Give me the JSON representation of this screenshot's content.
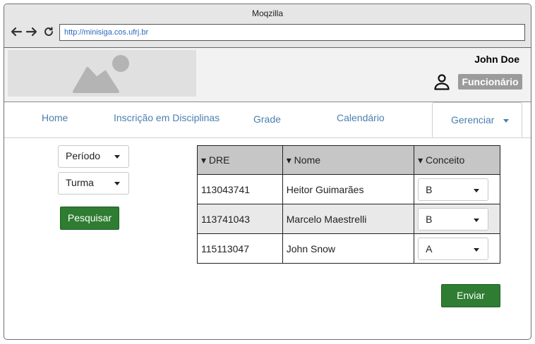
{
  "window": {
    "title": "Moqzilla"
  },
  "browser": {
    "url": "http://minisiga.cos.ufrj.br"
  },
  "header": {
    "user_name": "John Doe",
    "role": "Funcionário"
  },
  "tabs": [
    {
      "label": "Home"
    },
    {
      "label": "Inscrição em Disciplinas"
    },
    {
      "label": "Grade"
    },
    {
      "label": "Calendário"
    },
    {
      "label": "Gerenciar"
    }
  ],
  "filters": {
    "periodo": "Período",
    "turma": "Turma",
    "search_label": "Pesquisar"
  },
  "table": {
    "headers": [
      "▾ DRE",
      "▾ Nome",
      "▾ Conceito"
    ],
    "rows": [
      {
        "dre": "113043741",
        "nome": "Heitor Guimarães",
        "conceito": "B"
      },
      {
        "dre": "113741043",
        "nome": "Marcelo Maestrelli",
        "conceito": "B"
      },
      {
        "dre": "115113047",
        "nome": "John Snow",
        "conceito": "A"
      }
    ]
  },
  "submit_label": "Enviar",
  "colors": {
    "accent_green": "#2e7d32",
    "tab_blue": "#4a7fb0",
    "badge_gray": "#9b9b9b"
  }
}
